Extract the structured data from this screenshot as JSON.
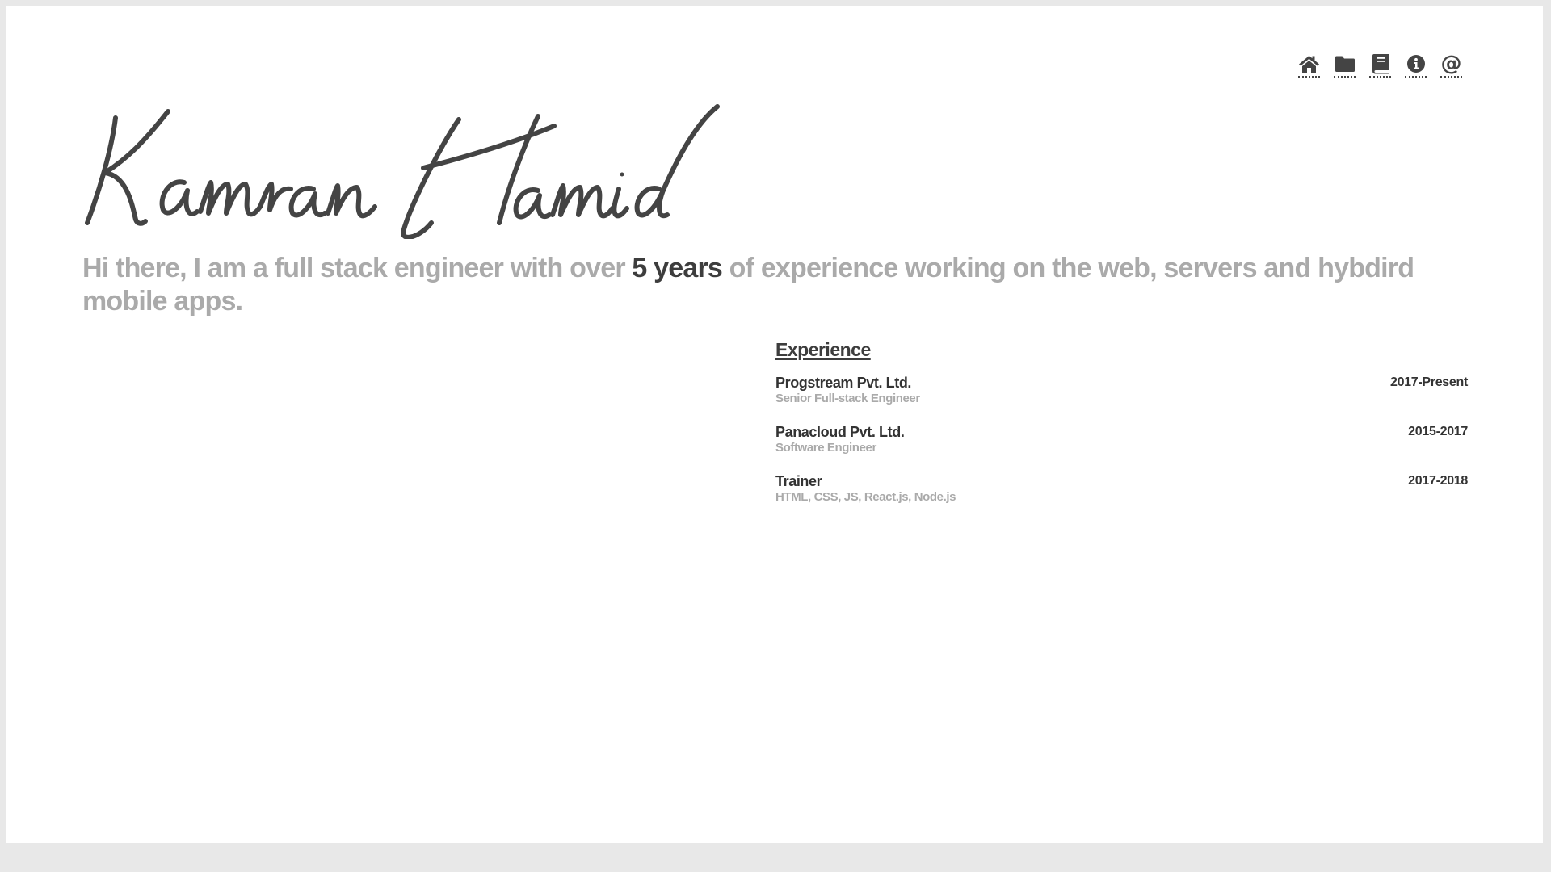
{
  "nav": [
    {
      "name": "home",
      "icon": "home-icon"
    },
    {
      "name": "projects",
      "icon": "folder-icon"
    },
    {
      "name": "blog",
      "icon": "book-icon"
    },
    {
      "name": "about",
      "icon": "info-icon"
    },
    {
      "name": "contact",
      "icon": "at-icon",
      "glyph": "@"
    }
  ],
  "header": {
    "name": "Kamran Hamid"
  },
  "intro": {
    "before": "Hi there, I am a full stack engineer with over ",
    "highlight": "5 years",
    "after": " of experience working on the web, servers and hybdird mobile apps."
  },
  "experience": {
    "heading": "Experience",
    "items": [
      {
        "company": "Progstream Pvt. Ltd.",
        "role": "Senior Full-stack Engineer",
        "years": "2017-Present"
      },
      {
        "company": "Panacloud Pvt. Ltd.",
        "role": "Software Engineer",
        "years": "2015-2017"
      },
      {
        "company": "Trainer",
        "role": "HTML, CSS, JS, React.js, Node.js",
        "years": "2017-2018"
      }
    ]
  },
  "colors": {
    "page_bg": "#e8e8e8",
    "card_bg": "#ffffff",
    "text_dark": "#3d3d3d",
    "text_muted": "#aaaaaa"
  }
}
